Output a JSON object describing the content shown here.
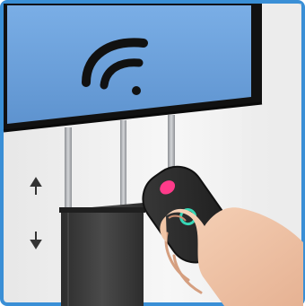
{
  "scene": {
    "frame_border_color": "#3a8fd6",
    "screen_color": "#6b9fd8",
    "bezel_color": "#1a1a1a",
    "wall_color": "#f2f2f2",
    "cabinet_color": "#3a3a3a",
    "pole_color": "#b9bcc0",
    "remote_color": "#2b2b2b",
    "remote_top_button_color": "#ff3b8a",
    "remote_bottom_button_color": "#37d6b5",
    "skin_color": "#f2c7ab"
  },
  "icons": {
    "screen_symbol": "wifi-signal-icon",
    "up": "arrow-up-icon",
    "down": "arrow-down-icon"
  }
}
